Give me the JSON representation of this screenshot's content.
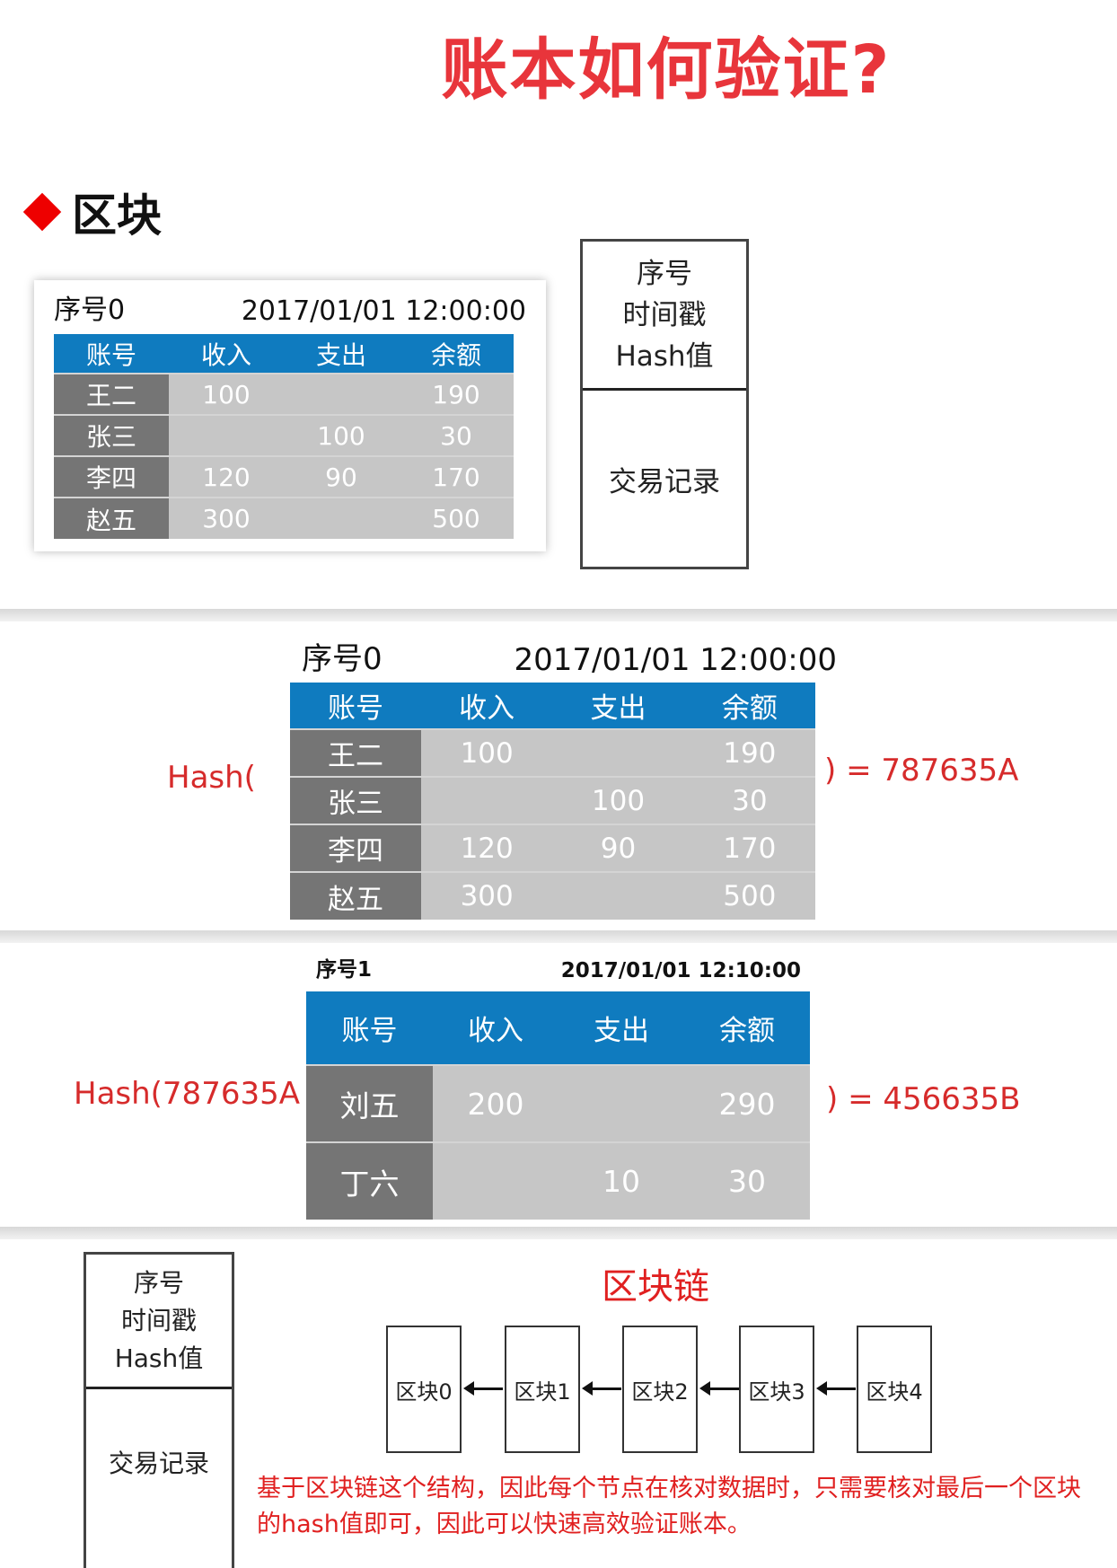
{
  "title": "账本如何验证?",
  "section": {
    "label": "区块"
  },
  "ledger0": {
    "seq": "序号0",
    "timestamp": "2017/01/01 12:00:00",
    "columns": [
      "账号",
      "收入",
      "支出",
      "余额"
    ],
    "rows": [
      [
        "王二",
        "100",
        "",
        "190"
      ],
      [
        "张三",
        "",
        "100",
        "30"
      ],
      [
        "李四",
        "120",
        "90",
        "170"
      ],
      [
        "赵五",
        "300",
        "",
        "500"
      ]
    ]
  },
  "block_structure": {
    "header_lines": [
      "序号",
      "时间戳",
      "Hash值"
    ],
    "body": "交易记录"
  },
  "hash_example_1": {
    "prefix": "Hash(",
    "result": ") = 787635A"
  },
  "ledger1": {
    "seq": "序号1",
    "timestamp": "2017/01/01 12:10:00",
    "columns": [
      "账号",
      "收入",
      "支出",
      "余额"
    ],
    "rows": [
      [
        "刘五",
        "200",
        "",
        "290"
      ],
      [
        "丁六",
        "",
        "10",
        "30"
      ]
    ]
  },
  "hash_example_2": {
    "prefix": "Hash(787635A ,",
    "result": ") = 456635B"
  },
  "chain": {
    "title": "区块链",
    "blocks": [
      "区块0",
      "区块1",
      "区块2",
      "区块3",
      "区块4"
    ]
  },
  "conclusion": "基于区块链这个结构，因此每个节点在核对数据时，只需要核对最后一个区块的hash值即可，因此可以快速高效验证账本。"
}
